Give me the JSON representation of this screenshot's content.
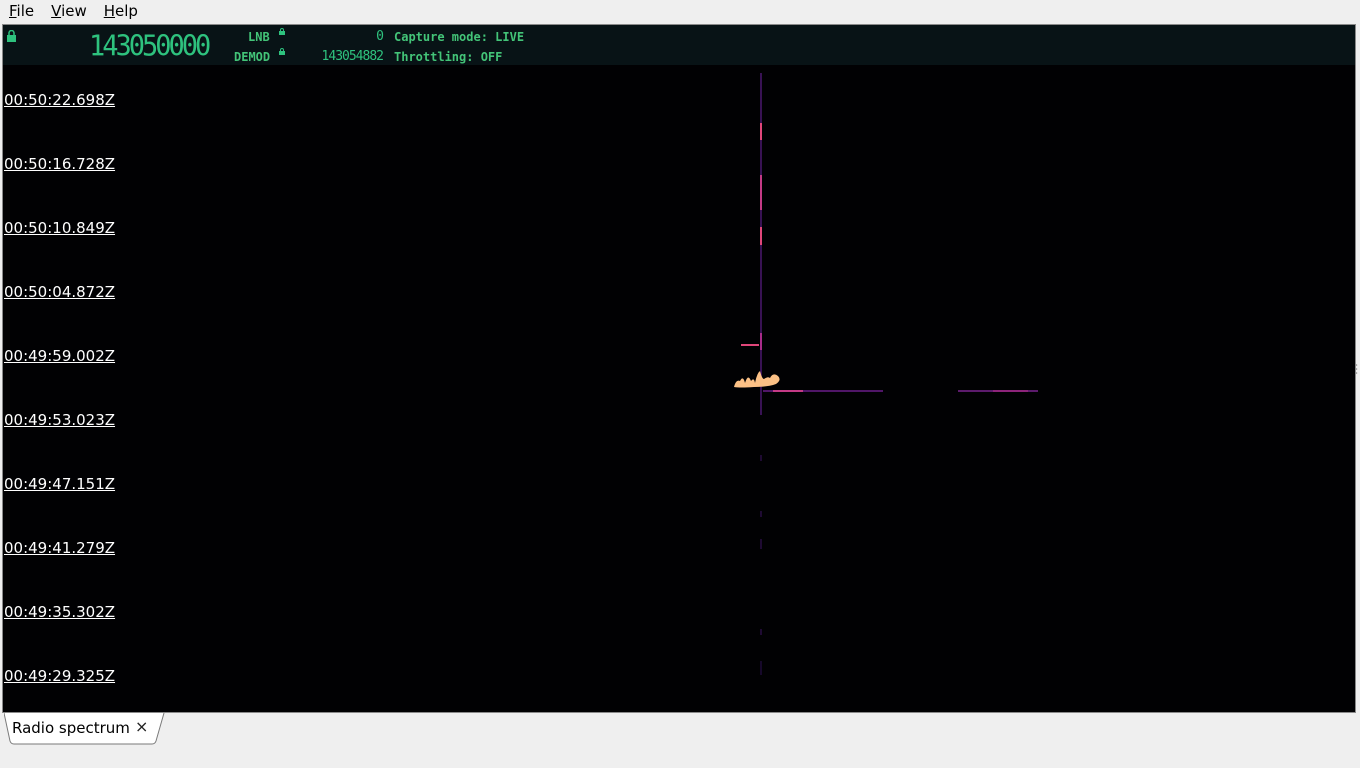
{
  "menu": [
    {
      "mnemonic": "F",
      "rest": "ile"
    },
    {
      "mnemonic": "V",
      "rest": "iew"
    },
    {
      "mnemonic": "H",
      "rest": "elp"
    }
  ],
  "header": {
    "main_frequency": "143050000",
    "lnb_label": "LNB",
    "lnb_value": "0",
    "demod_label": "DEMOD",
    "demod_value": "143054882",
    "capture_mode": "Capture mode: LIVE",
    "throttling": "Throttling: OFF"
  },
  "timestamps": [
    "00:50:22.698Z",
    "00:50:16.728Z",
    "00:50:10.849Z",
    "00:50:04.872Z",
    "00:49:59.002Z",
    "00:49:53.023Z",
    "00:49:47.151Z",
    "00:49:41.279Z",
    "00:49:35.302Z",
    "00:49:29.325Z"
  ],
  "tabs": [
    {
      "label": "Radio spectrum",
      "close": "×"
    }
  ],
  "colors": {
    "display_bg": "#010103",
    "header_bg": "#081316",
    "accent_green": "#2ec27e",
    "signal_hot": "#fcc186",
    "signal_mid": "#e0467a",
    "signal_low": "#6a1d8a"
  }
}
